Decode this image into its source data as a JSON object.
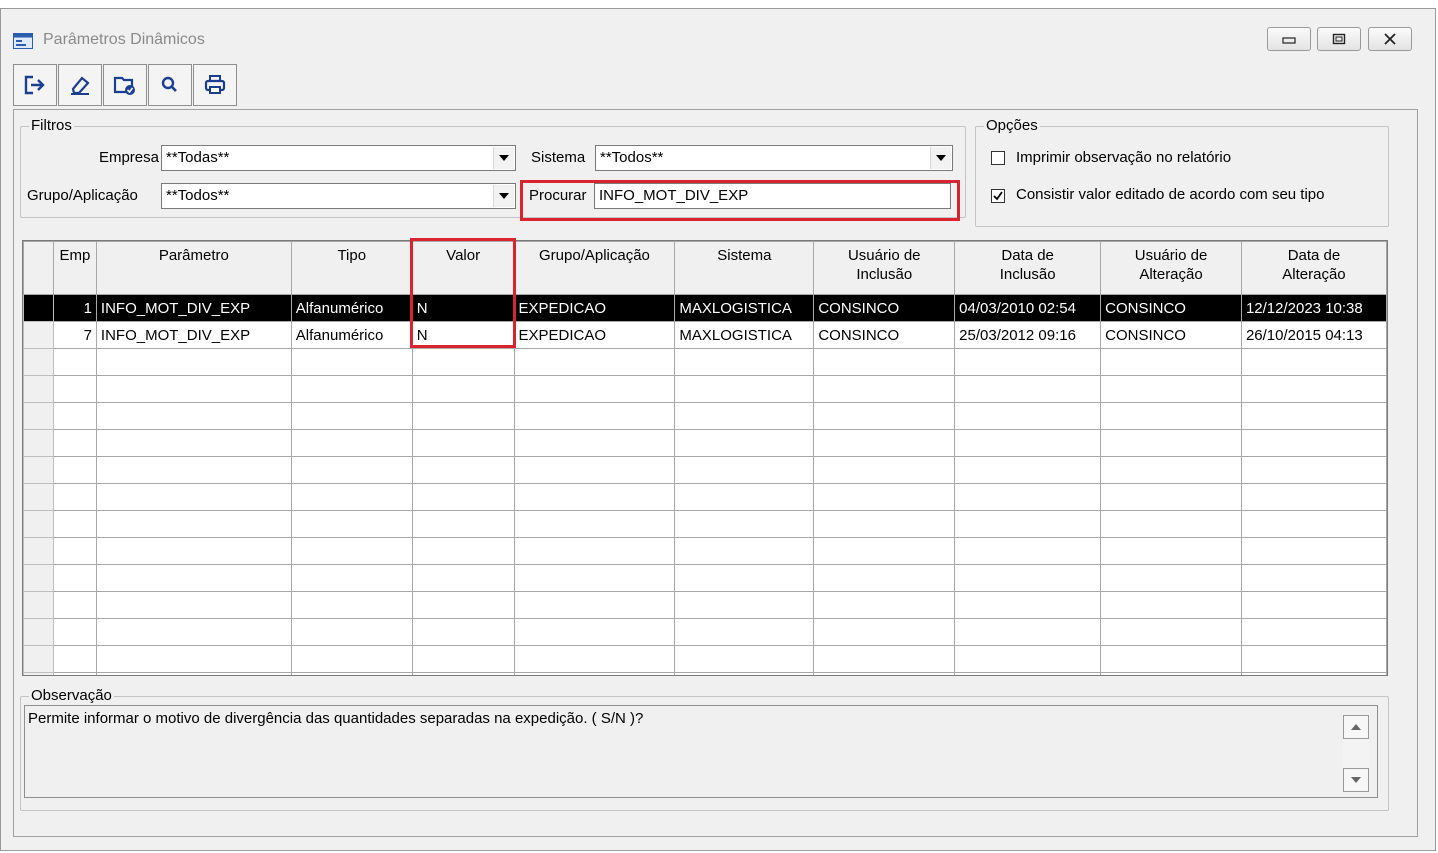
{
  "window": {
    "title": "Parâmetros Dinâmicos"
  },
  "toolbar": {
    "buttons": [
      {
        "icon": "exit-icon"
      },
      {
        "icon": "eraser-icon"
      },
      {
        "icon": "folder-check-icon"
      },
      {
        "icon": "search-icon"
      },
      {
        "icon": "print-icon"
      }
    ]
  },
  "filters": {
    "legend": "Filtros",
    "empresa_label": "Empresa",
    "empresa_value": "**Todas**",
    "sistema_label": "Sistema",
    "sistema_value": "**Todos**",
    "grupo_label": "Grupo/Aplicação",
    "grupo_value": "**Todos**",
    "procurar_label": "Procurar",
    "procurar_value": "INFO_MOT_DIV_EXP"
  },
  "options": {
    "legend": "Opções",
    "imprimir_label": "Imprimir observação no relatório",
    "imprimir_checked": false,
    "consistir_label": "Consistir valor editado de acordo com seu tipo",
    "consistir_checked": true
  },
  "grid": {
    "headers": {
      "emp": "Emp",
      "parametro": "Parâmetro",
      "tipo": "Tipo",
      "valor": "Valor",
      "grupo": "Grupo/Aplicação",
      "sistema": "Sistema",
      "usuario_inclusao_1": "Usuário de",
      "usuario_inclusao_2": "Inclusão",
      "data_inclusao_1": "Data de",
      "data_inclusao_2": "Inclusão",
      "usuario_alteracao_1": "Usuário de",
      "usuario_alteracao_2": "Alteração",
      "data_alteracao_1": "Data de",
      "data_alteracao_2": "Alteração"
    },
    "rows": [
      {
        "emp": "1",
        "parametro": "INFO_MOT_DIV_EXP",
        "tipo": "Alfanumérico",
        "valor": "N",
        "grupo": "EXPEDICAO",
        "sistema": "MAXLOGISTICA",
        "usuario_inclusao": "CONSINCO",
        "data_inclusao": "04/03/2010 02:54",
        "usuario_alteracao": "CONSINCO",
        "data_alteracao": "12/12/2023 10:38"
      },
      {
        "emp": "7",
        "parametro": "INFO_MOT_DIV_EXP",
        "tipo": "Alfanumérico",
        "valor": "N",
        "grupo": "EXPEDICAO",
        "sistema": "MAXLOGISTICA",
        "usuario_inclusao": "CONSINCO",
        "data_inclusao": "25/03/2012 09:16",
        "usuario_alteracao": "CONSINCO",
        "data_alteracao": "26/10/2015 04:13"
      }
    ],
    "selected_row": 0
  },
  "observacao": {
    "legend": "Observação",
    "text": "Permite informar o motivo de divergência das quantidades separadas na expedição. ( S/N )?"
  },
  "colors": {
    "highlight": "#d9242f",
    "selection": "#000000",
    "face": "#f0f0f0"
  }
}
